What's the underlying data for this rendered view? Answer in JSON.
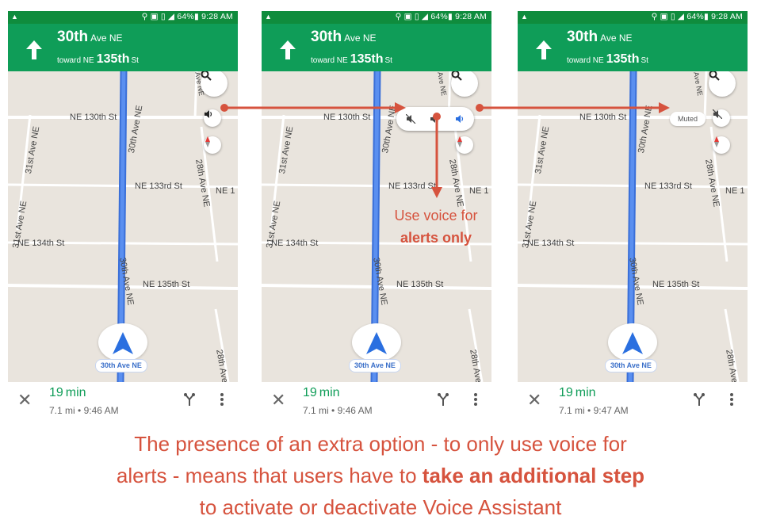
{
  "status": {
    "time": "9:28 AM",
    "battery": "64%",
    "time3": "9:28 AM"
  },
  "header": {
    "street_num": "30th",
    "street_suffix": "Ave NE",
    "toward_label": "toward NE",
    "toward_num": "135th",
    "toward_suffix": "St"
  },
  "map": {
    "labels": {
      "ne130": "NE 130th St",
      "ne133": "NE 133rd St",
      "ne134": "NE 134th St",
      "ne135": "NE 135th St",
      "ave30": "30th Ave NE",
      "ave31": "31st Ave NE",
      "ave28": "28th Ave NE",
      "ave28b": "28th Ave",
      "ne1": "NE 1",
      "avene": "Ave NE",
      "ave_top": "Ave NE"
    },
    "road_chip": "30th Ave NE"
  },
  "screens": [
    {
      "eta_min": "19",
      "eta_unit": "min",
      "distance": "7.1 mi",
      "arrival": "9:46 AM"
    },
    {
      "eta_min": "19",
      "eta_unit": "min",
      "distance": "7.1 mi",
      "arrival": "9:46 AM"
    },
    {
      "eta_min": "19",
      "eta_unit": "min",
      "distance": "7.1 mi",
      "arrival": "9:47 AM"
    }
  ],
  "muted_label": "Muted",
  "annotation": {
    "line1": "Use voice for",
    "line2": "alerts only"
  },
  "caption": {
    "line1": "The presence of an extra option - to only use voice for",
    "line2_pre": "alerts - means that users have to ",
    "line2_bold": "take an additional step",
    "line3": "to activate or deactivate Voice Assistant"
  },
  "icons": {
    "nav_arrow": "navigation-arrow-icon",
    "search": "search-icon",
    "sound": "volume-icon",
    "compass": "compass-icon"
  },
  "colors": {
    "green_header": "#0f9d58",
    "route_blue": "#4285f4",
    "annotation_red": "#d6533e"
  }
}
